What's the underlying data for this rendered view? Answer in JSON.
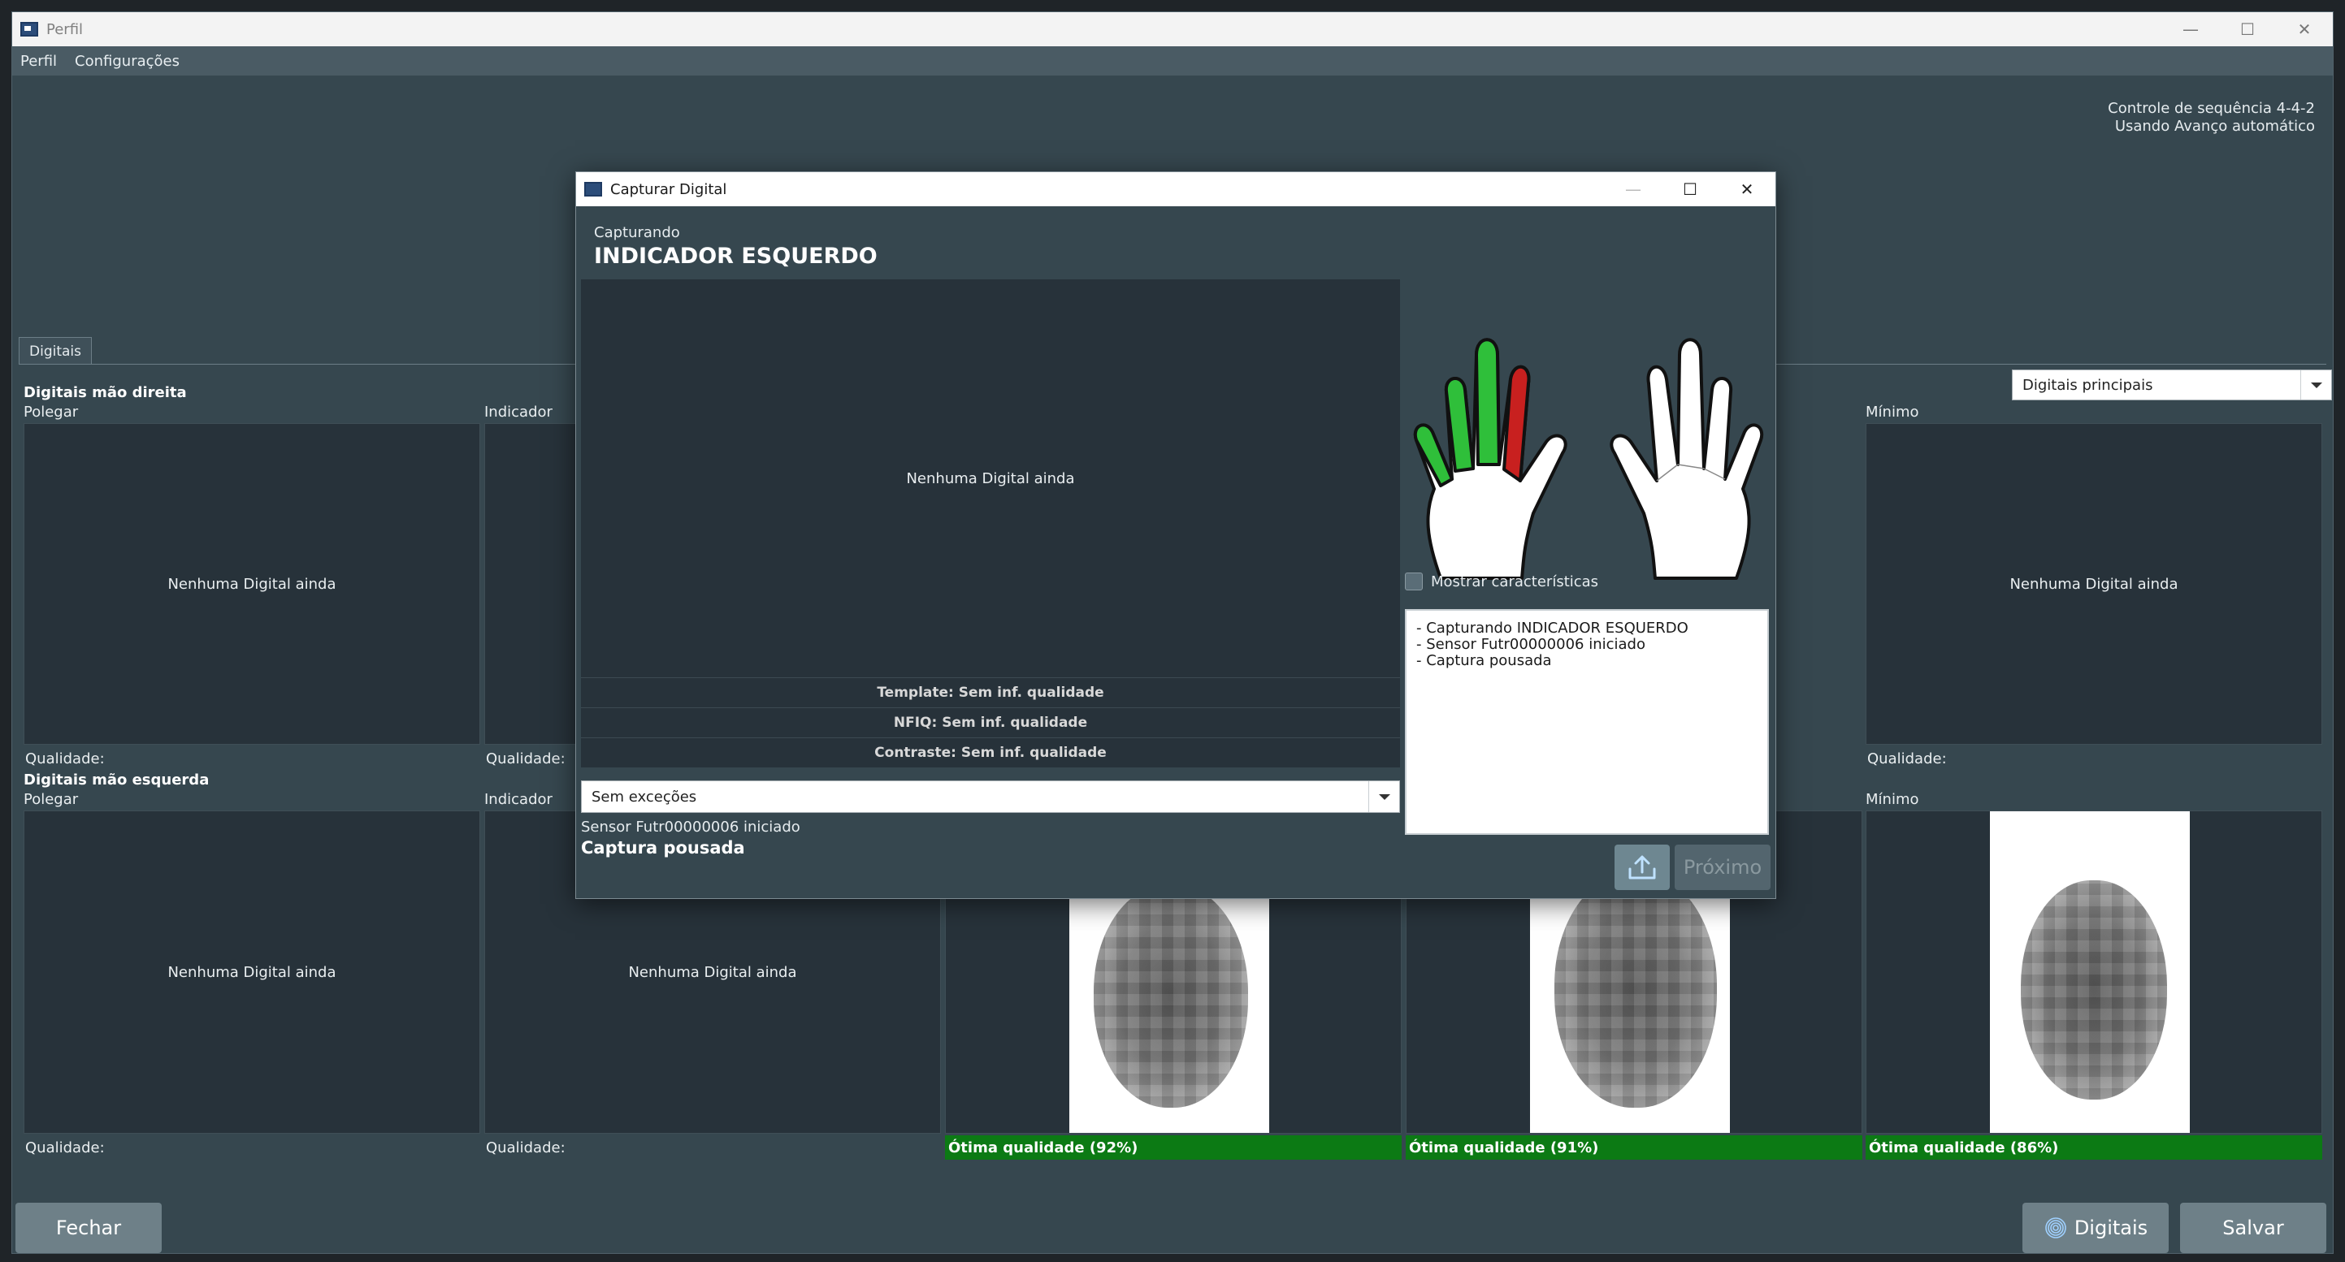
{
  "window": {
    "title": "Perfil",
    "controls": {
      "minimize": "—",
      "maximize": "☐",
      "close": "✕"
    }
  },
  "menu": {
    "items": [
      "Perfil",
      "Configurações"
    ]
  },
  "sequence": {
    "line1": "Controle de sequência 4-4-2",
    "line2": "Usando Avanço automático"
  },
  "tab": {
    "label": "Digitais"
  },
  "selector": {
    "value": "Digitais principais"
  },
  "right_hand": {
    "title": "Digitais mão direita",
    "cells": [
      {
        "finger": "Polegar",
        "text": "Nenhuma Digital ainda",
        "quality": "Qualidade:"
      },
      {
        "finger": "Indicador",
        "text": "",
        "quality": "Qualidade:"
      },
      {
        "finger": "Mínimo",
        "text": "Nenhuma Digital ainda",
        "quality": "Qualidade:"
      }
    ]
  },
  "left_hand": {
    "title": "Digitais mão esquerda",
    "cells": [
      {
        "finger": "Polegar",
        "text": "Nenhuma Digital ainda",
        "quality": "Qualidade:"
      },
      {
        "finger": "Indicador",
        "text": "Nenhuma Digital ainda",
        "quality": "Qualidade:"
      },
      {
        "finger": "",
        "text": "",
        "quality": "Ótima qualidade (92%)"
      },
      {
        "finger": "",
        "text": "",
        "quality": "Ótima qualidade (91%)"
      },
      {
        "finger": "Mínimo",
        "text": "",
        "quality": "Ótima qualidade (86%)"
      }
    ]
  },
  "buttons": {
    "close": "Fechar",
    "fingerprints": "Digitais",
    "save": "Salvar"
  },
  "dialog": {
    "title": "Capturar Digital",
    "subtitle": "Capturando",
    "finger": "INDICADOR ESQUERDO",
    "empty_text": "Nenhuma Digital ainda",
    "template": "Template: Sem inf. qualidade",
    "nfiq": "NFIQ: Sem inf. qualidade",
    "contrast": "Contraste: Sem inf. qualidade",
    "exception": "Sem exceções",
    "status1": "Sensor Futr00000006 iniciado",
    "status2": "Captura pousada",
    "show_features": "Mostrar características",
    "log": [
      "- Capturando INDICADOR ESQUERDO",
      "- Sensor Futr00000006 iniciado",
      "- Captura pousada"
    ],
    "next": "Próximo"
  },
  "colors": {
    "captured_finger": "#2fbf3a",
    "current_finger": "#c8201f",
    "good_quality": "#0c7a14",
    "panel": "#36474f",
    "cell": "#27323a"
  },
  "icons": {
    "app": "app-icon",
    "dropdown": "chevron-down-icon",
    "fingerprint": "fingerprint-icon",
    "upload": "upload-icon"
  }
}
